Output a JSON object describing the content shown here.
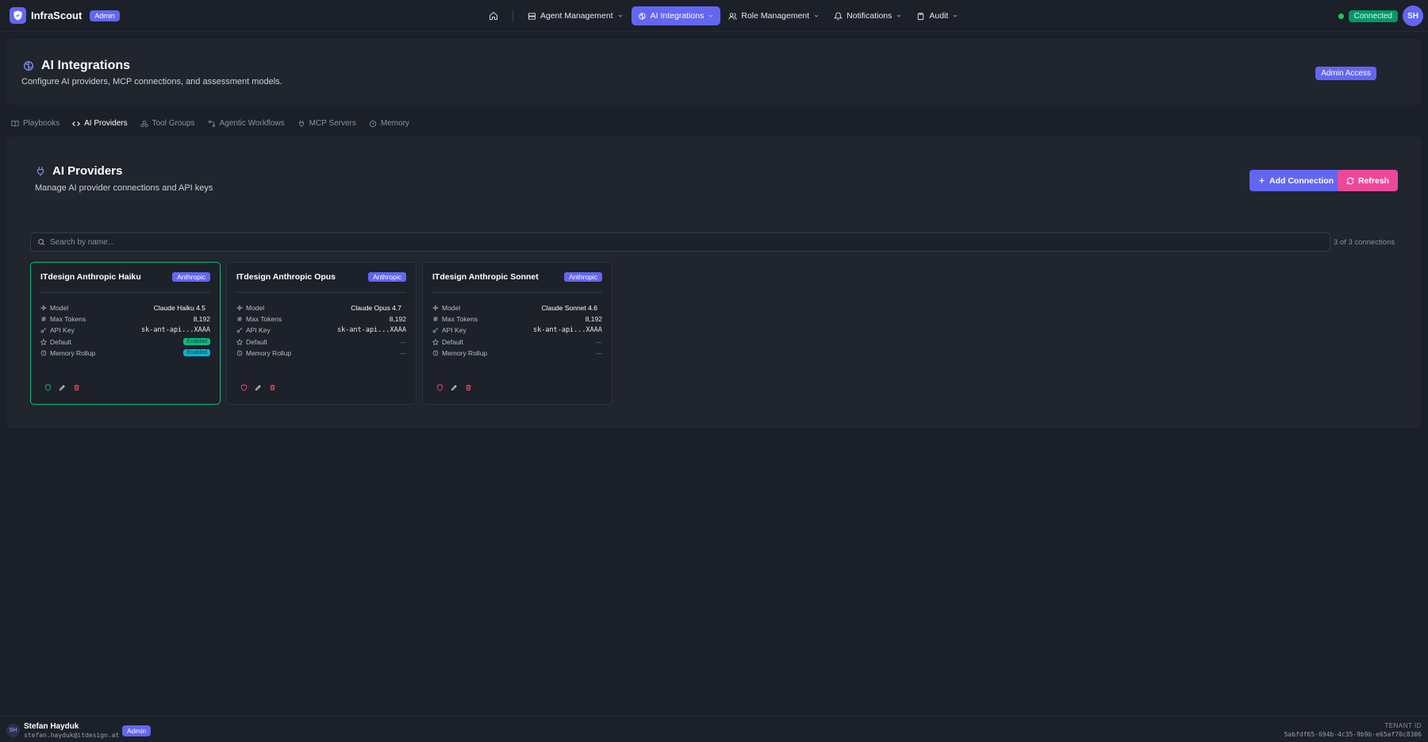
{
  "brand": {
    "name": "InfraScout",
    "badge": "Admin"
  },
  "nav": {
    "items": [
      {
        "label": "Agent Management",
        "icon": "server-icon",
        "active": false
      },
      {
        "label": "AI Integrations",
        "icon": "brain-icon",
        "active": true
      },
      {
        "label": "Role Management",
        "icon": "users-icon",
        "active": false
      },
      {
        "label": "Notifications",
        "icon": "bell-icon",
        "active": false
      },
      {
        "label": "Audit",
        "icon": "clipboard-icon",
        "active": false
      }
    ],
    "status": "Connected",
    "avatar_initials": "SH"
  },
  "page": {
    "title": "AI Integrations",
    "subtitle": "Configure AI providers, MCP connections, and assessment models.",
    "access_badge": "Admin Access"
  },
  "tabs": [
    {
      "label": "Playbooks",
      "icon": "book-icon"
    },
    {
      "label": "AI Providers",
      "icon": "code-icon",
      "active": true
    },
    {
      "label": "Tool Groups",
      "icon": "tools-icon"
    },
    {
      "label": "Agentic Workflows",
      "icon": "workflow-icon"
    },
    {
      "label": "MCP Servers",
      "icon": "plug-icon"
    },
    {
      "label": "Memory",
      "icon": "memory-icon"
    }
  ],
  "section": {
    "title": "AI Providers",
    "subtitle": "Manage AI provider connections and API keys",
    "add_label": "Add Connection",
    "refresh_label": "Refresh",
    "search_placeholder": "Search by name...",
    "count": "3 of 3 connections"
  },
  "row_labels": {
    "model": "Model",
    "max_tokens": "Max Tokens",
    "api_key": "API Key",
    "default": "Default",
    "memory_rollup": "Memory Rollup"
  },
  "cards": [
    {
      "name": "ITdesign Anthropic Haiku",
      "provider": "Anthropic",
      "model": "Claude Haiku 4.5",
      "max_tokens": "8,192",
      "api_key": "sk-ant-api...XAAA",
      "default": "Enabled",
      "memory_rollup": "Enabled"
    },
    {
      "name": "ITdesign Anthropic Opus",
      "provider": "Anthropic",
      "model": "Claude Opus 4.7",
      "max_tokens": "8,192",
      "api_key": "sk-ant-api...XAAA",
      "default": "—",
      "memory_rollup": "—"
    },
    {
      "name": "ITdesign Anthropic Sonnet",
      "provider": "Anthropic",
      "model": "Claude Sonnet 4.6",
      "max_tokens": "8,192",
      "api_key": "sk-ant-api...XAAA",
      "default": "—",
      "memory_rollup": "—"
    }
  ],
  "footer": {
    "avatar_initials": "SH",
    "name": "Stefan Hayduk",
    "email": "stefan.hayduk@itdesign.at",
    "role": "Admin",
    "tenant_label": "TENANT ID",
    "tenant_id": "5abfdf65-694b-4c35-9b9b-e65af70c8306"
  },
  "colors": {
    "accent": "#6366f1",
    "pink": "#ec4899",
    "success": "#10b981",
    "background": "#1b1f27"
  }
}
